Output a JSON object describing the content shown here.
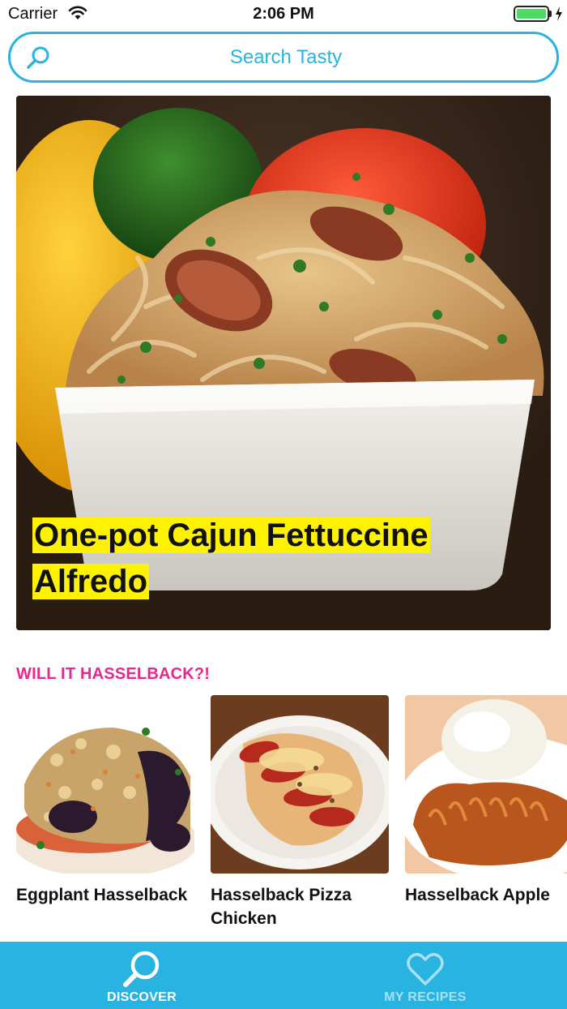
{
  "status_bar": {
    "carrier": "Carrier",
    "time": "2:06 PM",
    "battery_level": 1.0
  },
  "search": {
    "placeholder": "Search Tasty",
    "icon": "search-icon"
  },
  "hero": {
    "title": "One-pot Cajun Fettuccine Alfredo",
    "highlight_color": "#fff200"
  },
  "section": {
    "title": "WILL IT HASSELBACK?!",
    "title_color": "#e8288c",
    "items": [
      {
        "title": "Eggplant Hasselback"
      },
      {
        "title": "Hasselback Pizza Chicken"
      },
      {
        "title": "Hasselback Apple"
      }
    ]
  },
  "tab_bar": {
    "background": "#28b3e0",
    "tabs": [
      {
        "label": "DISCOVER",
        "icon": "search-icon",
        "active": true
      },
      {
        "label": "MY RECIPES",
        "icon": "heart-icon",
        "active": false
      }
    ]
  },
  "colors": {
    "accent": "#28b3e0"
  }
}
